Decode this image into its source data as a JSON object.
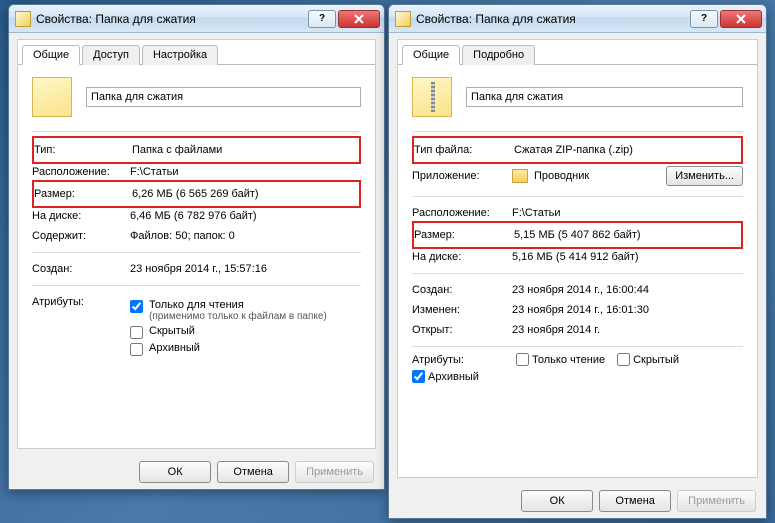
{
  "left": {
    "title": "Свойства: Папка для сжатия",
    "tabs": {
      "t1": "Общие",
      "t2": "Доступ",
      "t3": "Настройка"
    },
    "name": "Папка для сжатия",
    "rows": {
      "type_lbl": "Тип:",
      "type_val": "Папка с файлами",
      "loc_lbl": "Расположение:",
      "loc_val": "F:\\Статьи",
      "size_lbl": "Размер:",
      "size_val": "6,26 МБ (6 565 269 байт)",
      "disk_lbl": "На диске:",
      "disk_val": "6,46 МБ (6 782 976 байт)",
      "cont_lbl": "Содержит:",
      "cont_val": "Файлов: 50; папок: 0",
      "created_lbl": "Создан:",
      "created_val": "23 ноября 2014 г., 15:57:16",
      "attr_lbl": "Атрибуты:"
    },
    "attrs": {
      "readonly": "Только для чтения",
      "readonly_sub": "(применимо только к файлам в папке)",
      "hidden": "Скрытый",
      "archive": "Архивный"
    },
    "buttons": {
      "ok": "ОК",
      "cancel": "Отмена",
      "apply": "Применить"
    }
  },
  "right": {
    "title": "Свойства: Папка для сжатия",
    "tabs": {
      "t1": "Общие",
      "t2": "Подробно"
    },
    "name": "Папка для сжатия",
    "rows": {
      "type_lbl": "Тип файла:",
      "type_val": "Сжатая ZIP-папка (.zip)",
      "app_lbl": "Приложение:",
      "app_val": "Проводник",
      "app_btn": "Изменить...",
      "loc_lbl": "Расположение:",
      "loc_val": "F:\\Статьи",
      "size_lbl": "Размер:",
      "size_val": "5,15 МБ (5 407 862 байт)",
      "disk_lbl": "На диске:",
      "disk_val": "5,16 МБ (5 414 912 байт)",
      "created_lbl": "Создан:",
      "created_val": "23 ноября 2014 г., 16:00:44",
      "modified_lbl": "Изменен:",
      "modified_val": "23 ноября 2014 г., 16:01:30",
      "opened_lbl": "Открыт:",
      "opened_val": "23 ноября 2014 г."
    },
    "attr_lbl": "Атрибуты:",
    "attrs": {
      "readonly": "Только чтение",
      "hidden": "Скрытый",
      "archive": "Архивный"
    },
    "buttons": {
      "ok": "ОК",
      "cancel": "Отмена",
      "apply": "Применить"
    }
  }
}
